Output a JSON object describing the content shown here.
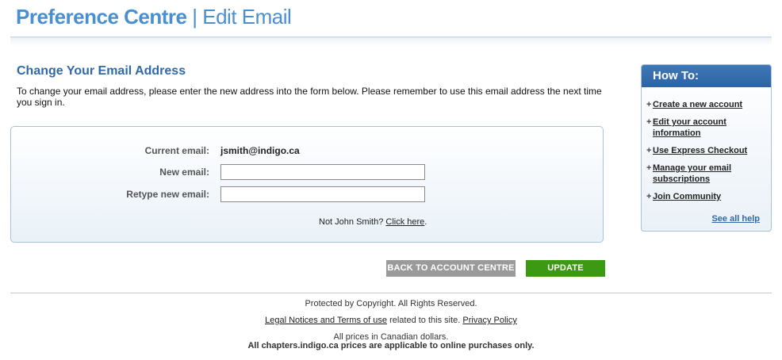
{
  "header": {
    "title_main": "Preference Centre",
    "separator": "|",
    "title_sub": "Edit Email"
  },
  "main": {
    "heading": "Change Your Email Address",
    "intro": "To change your email address, please enter the new address into the form below. Please remember to use this email address the next time you sign in.",
    "form": {
      "current_label": "Current email:",
      "current_value": "jsmith@indigo.ca",
      "new_label": "New email:",
      "new_value": "",
      "retype_label": "Retype new email:",
      "retype_value": "",
      "not_user_prefix": "Not John Smith?",
      "not_user_link": "Click here",
      "not_user_suffix": "."
    },
    "buttons": {
      "back": "BACK TO ACCOUNT CENTRE",
      "update": "UPDATE"
    }
  },
  "howto": {
    "title": "How To:",
    "items": [
      {
        "label": "Create a new account"
      },
      {
        "label": "Edit your account information"
      },
      {
        "label": "Use Express Checkout"
      },
      {
        "label": "Manage your email subscriptions"
      },
      {
        "label": "Join Community"
      }
    ],
    "see_all": "See all help"
  },
  "footer": {
    "copyright": "Protected by Copyright. All Rights Reserved.",
    "legal_link": "Legal Notices and Terms of use",
    "legal_middle": "related to this site.",
    "privacy_link": "Privacy Policy",
    "prices": "All prices in Canadian dollars.",
    "prices_note": "All chapters.indigo.ca prices are applicable to online purchases only."
  },
  "colors": {
    "brand_blue": "#4a8fd0",
    "heading_blue": "#2f69a8",
    "update_green": "#3c9a12",
    "back_gray": "#9a9a9a"
  }
}
